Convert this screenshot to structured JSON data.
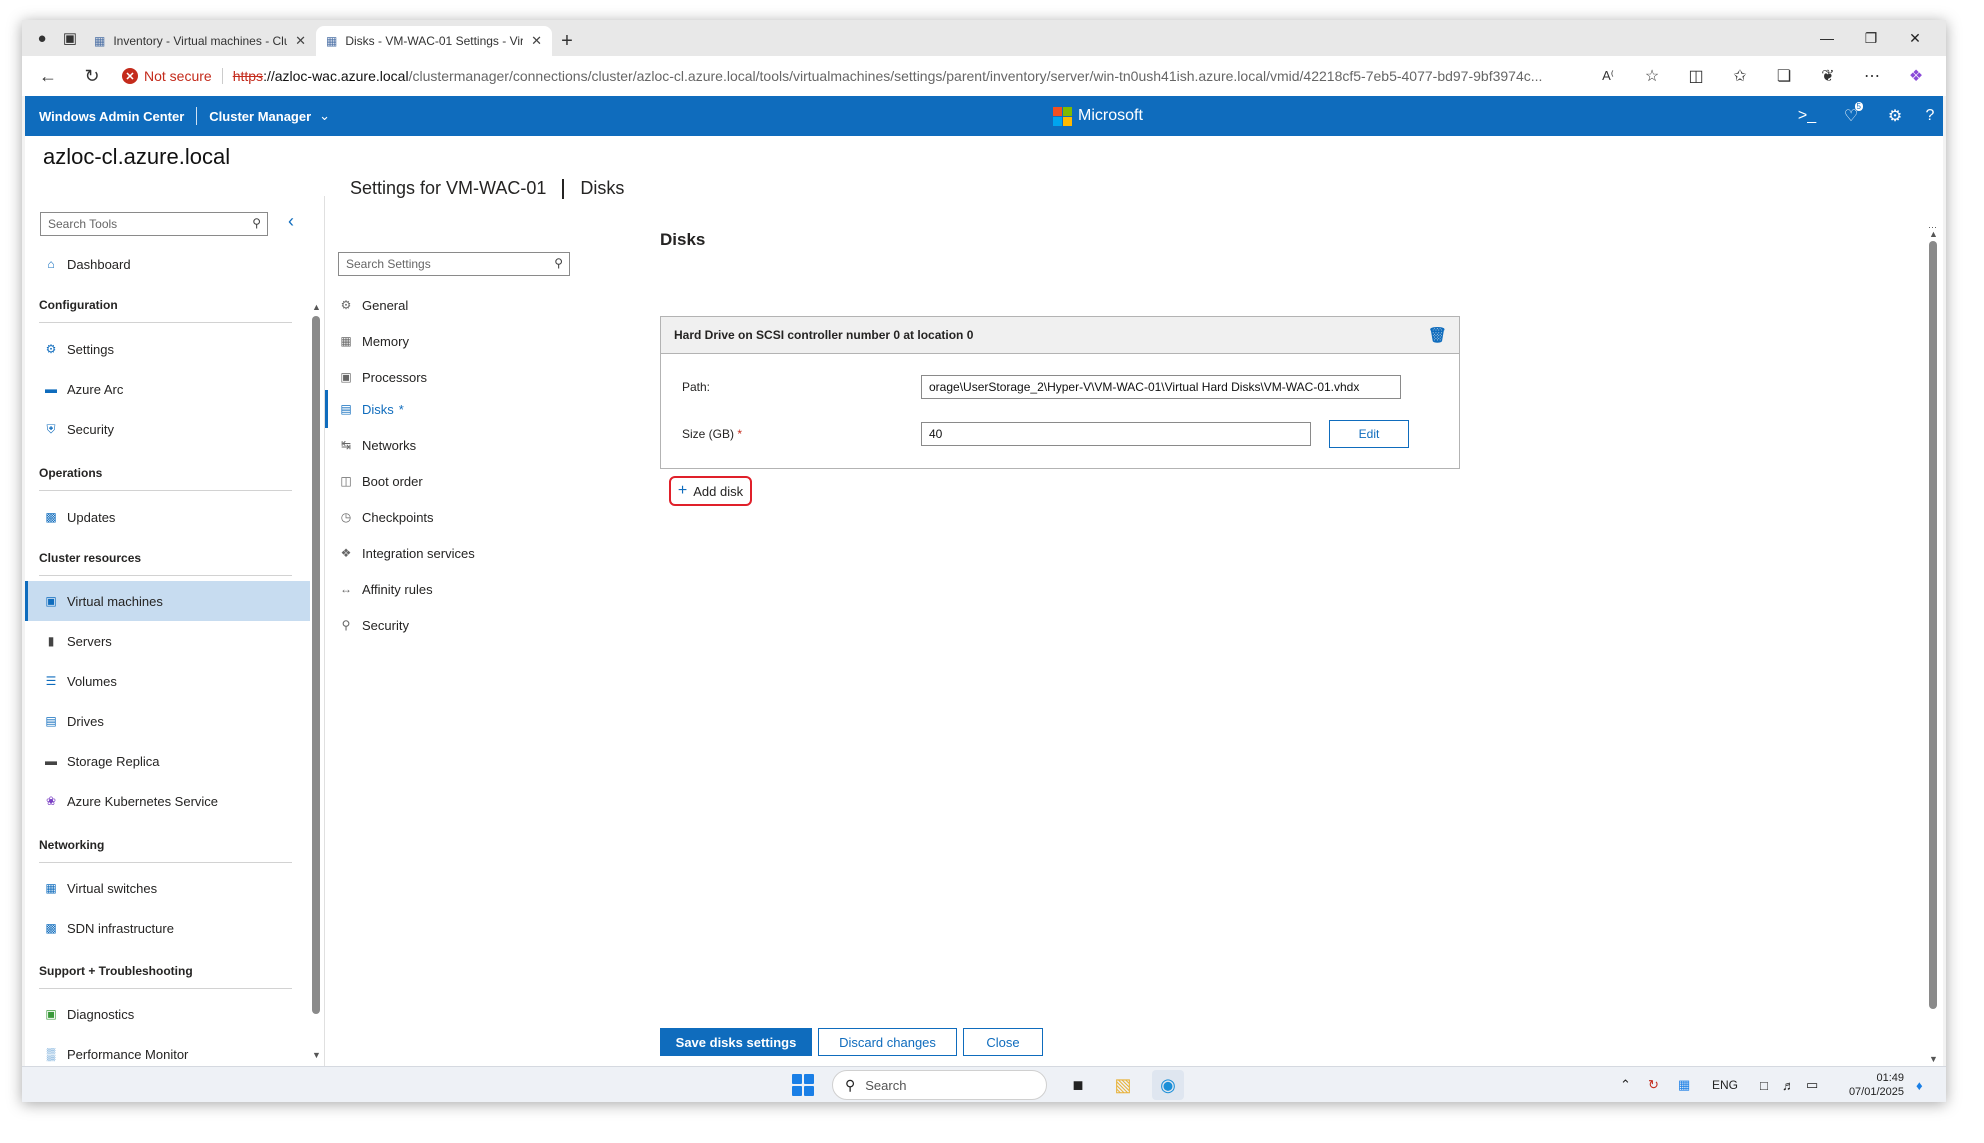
{
  "browser": {
    "tabs": [
      {
        "label": "Inventory - Virtual machines - Clu",
        "active": false
      },
      {
        "label": "Disks - VM-WAC-01 Settings - Vir",
        "active": true
      }
    ],
    "security_label": "Not secure",
    "url_scheme": "https",
    "url_host": "://azloc-wac.azure.local",
    "url_path": "/clustermanager/connections/cluster/azloc-cl.azure.local/tools/virtualmachines/settings/parent/inventory/server/win-tn0ush41ish.azure.local/vmid/42218cf5-7eb5-4077-bd97-9bf3974c..."
  },
  "appbar": {
    "product": "Windows Admin Center",
    "context": "Cluster Manager",
    "brand": "Microsoft",
    "notification_count": "5"
  },
  "cluster_name": "azloc-cl.azure.local",
  "leftnav": {
    "search_placeholder": "Search Tools",
    "dashboard": "Dashboard",
    "sections": {
      "configuration": "Configuration",
      "operations": "Operations",
      "cluster_resources": "Cluster resources",
      "networking": "Networking",
      "support": "Support + Troubleshooting"
    },
    "items": {
      "settings": "Settings",
      "azure_arc": "Azure Arc",
      "security": "Security",
      "updates": "Updates",
      "virtual_machines": "Virtual machines",
      "servers": "Servers",
      "volumes": "Volumes",
      "drives": "Drives",
      "storage_replica": "Storage Replica",
      "aks": "Azure Kubernetes Service",
      "virtual_switches": "Virtual switches",
      "sdn": "SDN infrastructure",
      "diagnostics": "Diagnostics",
      "perfmon": "Performance Monitor"
    },
    "selected": "virtual_machines"
  },
  "settings": {
    "title": "Settings for VM-WAC-01",
    "subtitle": "Disks",
    "search_placeholder": "Search Settings",
    "items": {
      "general": "General",
      "memory": "Memory",
      "processors": "Processors",
      "disks": "Disks",
      "networks": "Networks",
      "boot_order": "Boot order",
      "checkpoints": "Checkpoints",
      "integration": "Integration services",
      "affinity": "Affinity rules",
      "security": "Security"
    },
    "modified_marker": "*"
  },
  "disks": {
    "title": "Disks",
    "card_title": "Hard Drive on SCSI controller number 0 at location 0",
    "path_label": "Path:",
    "path_value": "orage\\UserStorage_2\\Hyper-V\\VM-WAC-01\\Virtual Hard Disks\\VM-WAC-01.vhdx",
    "size_label": "Size (GB)",
    "required_marker": "*",
    "size_value": "40",
    "edit_label": "Edit",
    "add_disk_label": "Add disk"
  },
  "footer": {
    "save": "Save disks settings",
    "discard": "Discard changes",
    "close": "Close"
  },
  "taskbar": {
    "search_placeholder": "Search",
    "lang": "ENG",
    "time": "01:49",
    "date": "07/01/2025"
  },
  "colors": {
    "accent": "#0f6cbd",
    "danger": "#c42b1c",
    "highlight_box": "#e0202a"
  }
}
